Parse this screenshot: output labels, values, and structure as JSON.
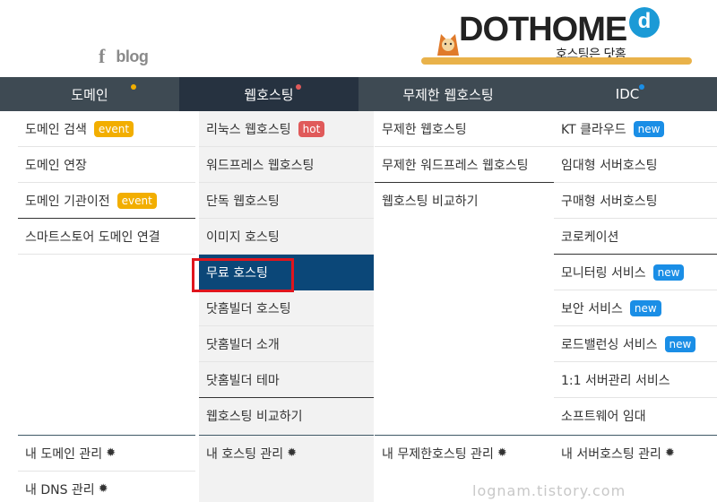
{
  "header": {
    "social": {
      "facebook_icon": "facebook-icon",
      "blog_label": "blog"
    },
    "logo": {
      "brand": "DOTHOME",
      "logo_mark": "d",
      "tagline": "호스팅은 닷홈"
    }
  },
  "nav": {
    "tabs": [
      {
        "label": "도메인",
        "dot_color": "#f2ae00",
        "active": false
      },
      {
        "label": "웹호스팅",
        "dot_color": "#e05a5a",
        "active": true
      },
      {
        "label": "무제한 웹호스팅",
        "dot_color": "",
        "active": false
      },
      {
        "label": "IDC",
        "dot_color": "#1a8ee6",
        "active": false
      }
    ]
  },
  "columns": {
    "domain": {
      "items": [
        {
          "label": "도메인 검색",
          "badge": "event"
        },
        {
          "label": "도메인 연장",
          "badge": ""
        },
        {
          "label": "도메인 기관이전",
          "badge": "event"
        },
        {
          "label": "스마트스토어 도메인 연결",
          "badge": ""
        }
      ],
      "manage": [
        {
          "label": "내 도메인 관리"
        },
        {
          "label": "내 DNS 관리"
        }
      ]
    },
    "webhosting": {
      "items": [
        {
          "label": "리눅스 웹호스팅",
          "badge": "hot"
        },
        {
          "label": "워드프레스 웹호스팅",
          "badge": ""
        },
        {
          "label": "단독 웹호스팅",
          "badge": ""
        },
        {
          "label": "이미지 호스팅",
          "badge": ""
        },
        {
          "label": "무료 호스팅",
          "badge": "",
          "selected": true
        },
        {
          "label": "닷홈빌더 호스팅",
          "badge": ""
        },
        {
          "label": "닷홈빌더 소개",
          "badge": ""
        },
        {
          "label": "닷홈빌더 테마",
          "badge": ""
        },
        {
          "label": "웹호스팅 비교하기",
          "badge": ""
        }
      ],
      "manage": [
        {
          "label": "내 호스팅 관리"
        }
      ]
    },
    "unlimited": {
      "items": [
        {
          "label": "무제한 웹호스팅"
        },
        {
          "label": "무제한 워드프레스 웹호스팅"
        },
        {
          "label": "웹호스팅 비교하기"
        }
      ],
      "manage": [
        {
          "label": "내 무제한호스팅 관리"
        }
      ]
    },
    "idc": {
      "items": [
        {
          "label": "KT 클라우드",
          "badge": "new"
        },
        {
          "label": "임대형 서버호스팅",
          "badge": ""
        },
        {
          "label": "구매형 서버호스팅",
          "badge": ""
        },
        {
          "label": "코로케이션",
          "badge": ""
        },
        {
          "label": "모니터링 서비스",
          "badge": "new"
        },
        {
          "label": "보안 서비스",
          "badge": "new"
        },
        {
          "label": "로드밸런싱 서비스",
          "badge": "new"
        },
        {
          "label": "1:1 서버관리 서비스",
          "badge": ""
        },
        {
          "label": "소프트웨어 임대",
          "badge": ""
        }
      ],
      "manage": [
        {
          "label": "내 서버호스팅 관리"
        }
      ]
    }
  },
  "watermark": "lognam.tistory.com",
  "colors": {
    "nav_bg": "#3e4a53",
    "nav_active_bg": "#263240",
    "selected_bg": "#0b4778",
    "highlight": "#e0151d"
  }
}
